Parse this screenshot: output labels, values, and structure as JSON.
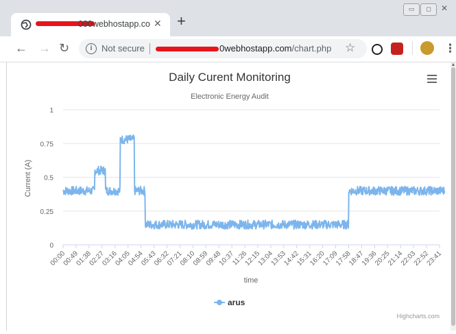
{
  "browser": {
    "tab_title": "000webhostapp.co",
    "tab_close": "✕",
    "new_tab": "+",
    "not_secure": "Not secure",
    "url_host": "0webhostapp.com",
    "url_path": "/chart.php"
  },
  "chart_data": {
    "type": "line",
    "title": "Daily Curent Monitoring",
    "subtitle": "Electronic Energy Audit",
    "xlabel": "time",
    "ylabel": "Current (A)",
    "ylim": [
      0,
      1
    ],
    "yticks": [
      "0",
      "0.25",
      "0.5",
      "0.75",
      "1"
    ],
    "categories": [
      "00:00",
      "00:49",
      "01:38",
      "02:27",
      "03:16",
      "04:05",
      "04:54",
      "05:43",
      "06:32",
      "07:21",
      "08:10",
      "08:59",
      "09:48",
      "10:37",
      "11:26",
      "12:15",
      "13:04",
      "13:53",
      "14:42",
      "15:31",
      "16:20",
      "17:09",
      "17:58",
      "18:47",
      "19:36",
      "20:25",
      "21:14",
      "22:03",
      "22:52",
      "23:41"
    ],
    "series": [
      {
        "name": "arus",
        "color": "#7cb5ec",
        "segments": [
          {
            "from": "00:00",
            "to": "02:00",
            "level": 0.4
          },
          {
            "from": "02:00",
            "to": "02:40",
            "level": 0.55
          },
          {
            "from": "02:40",
            "to": "03:35",
            "level": 0.4
          },
          {
            "from": "03:35",
            "to": "04:30",
            "level": 0.78
          },
          {
            "from": "04:30",
            "to": "05:10",
            "level": 0.4
          },
          {
            "from": "05:10",
            "to": "17:58",
            "level": 0.15
          },
          {
            "from": "17:58",
            "to": "24:00",
            "level": 0.4
          }
        ]
      }
    ],
    "legend_position": "bottom",
    "credits": "Highcharts.com",
    "menu_icon": "hamburger-icon"
  }
}
